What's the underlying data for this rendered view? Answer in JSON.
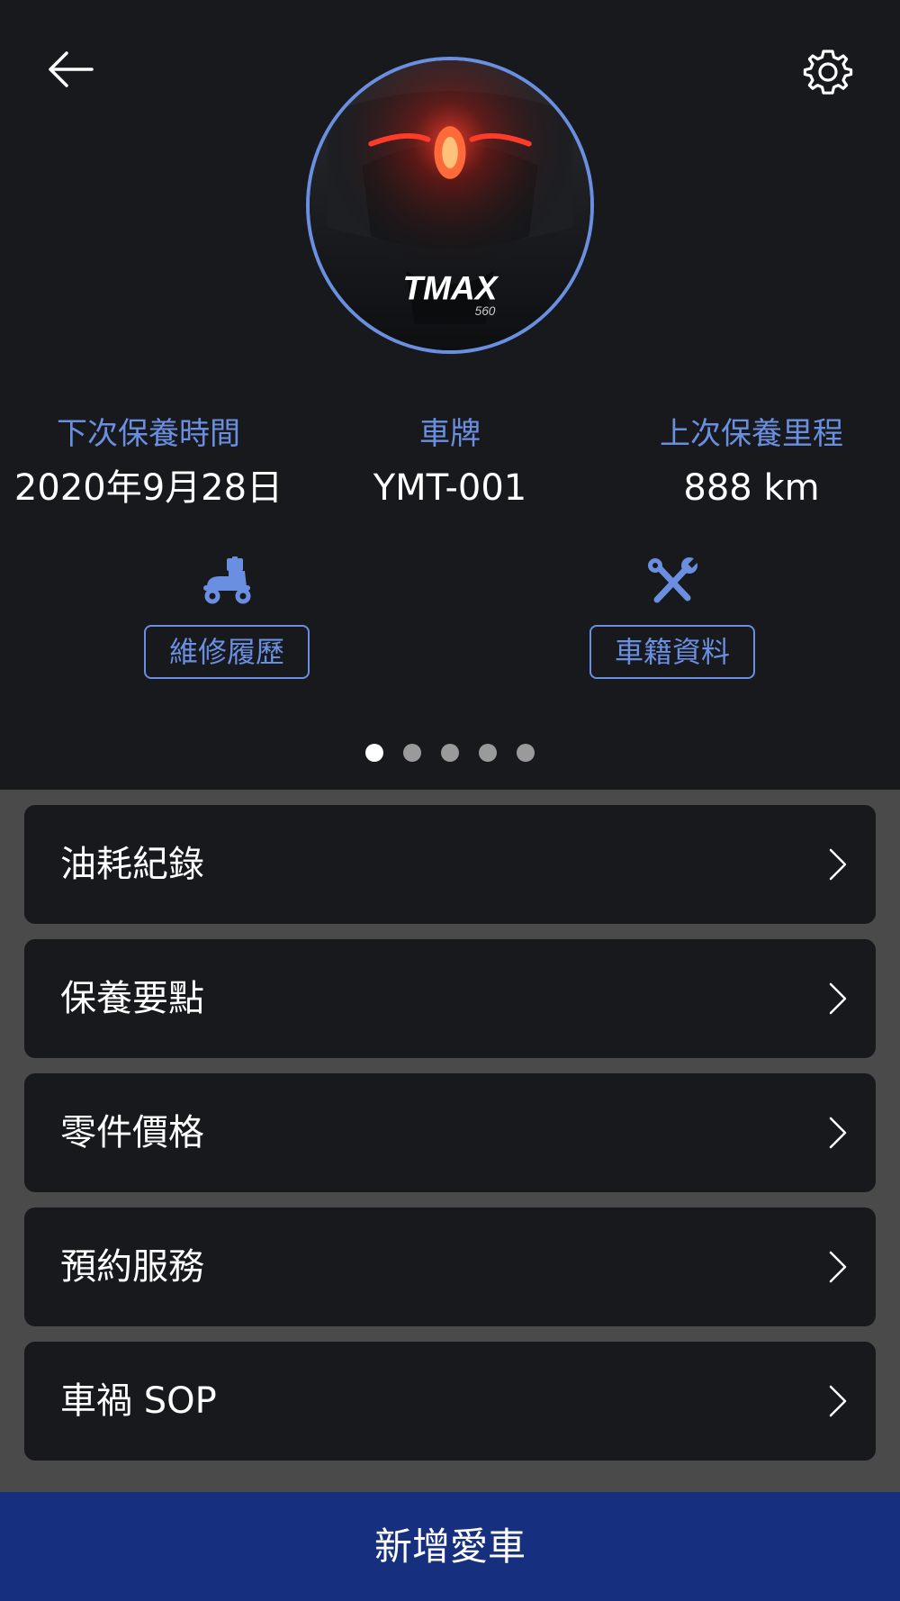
{
  "header": {
    "back_icon": "arrow-left-icon",
    "settings_icon": "gear-icon"
  },
  "vehicle": {
    "logo_text": "TMAX",
    "logo_subtext": "560"
  },
  "stats": [
    {
      "label": "下次保養時間",
      "value": "2020年9月28日"
    },
    {
      "label": "車牌",
      "value": "YMT-001"
    },
    {
      "label": "上次保養里程",
      "value": "888 km"
    }
  ],
  "actions": [
    {
      "label": "維修履歷",
      "icon": "scooter-icon"
    },
    {
      "label": "車籍資料",
      "icon": "tools-icon"
    }
  ],
  "pager": {
    "total": 5,
    "active": 1
  },
  "menu": [
    {
      "label": "油耗紀錄"
    },
    {
      "label": "保養要點"
    },
    {
      "label": "零件價格"
    },
    {
      "label": "預約服務"
    },
    {
      "label": "車禍 SOP"
    }
  ],
  "footer": {
    "add_label": "新增愛車"
  },
  "colors": {
    "accent": "#6b8fe0",
    "background_dark": "#18191d",
    "background_gray": "#4a4a4a",
    "footer_blue": "#16307f"
  }
}
